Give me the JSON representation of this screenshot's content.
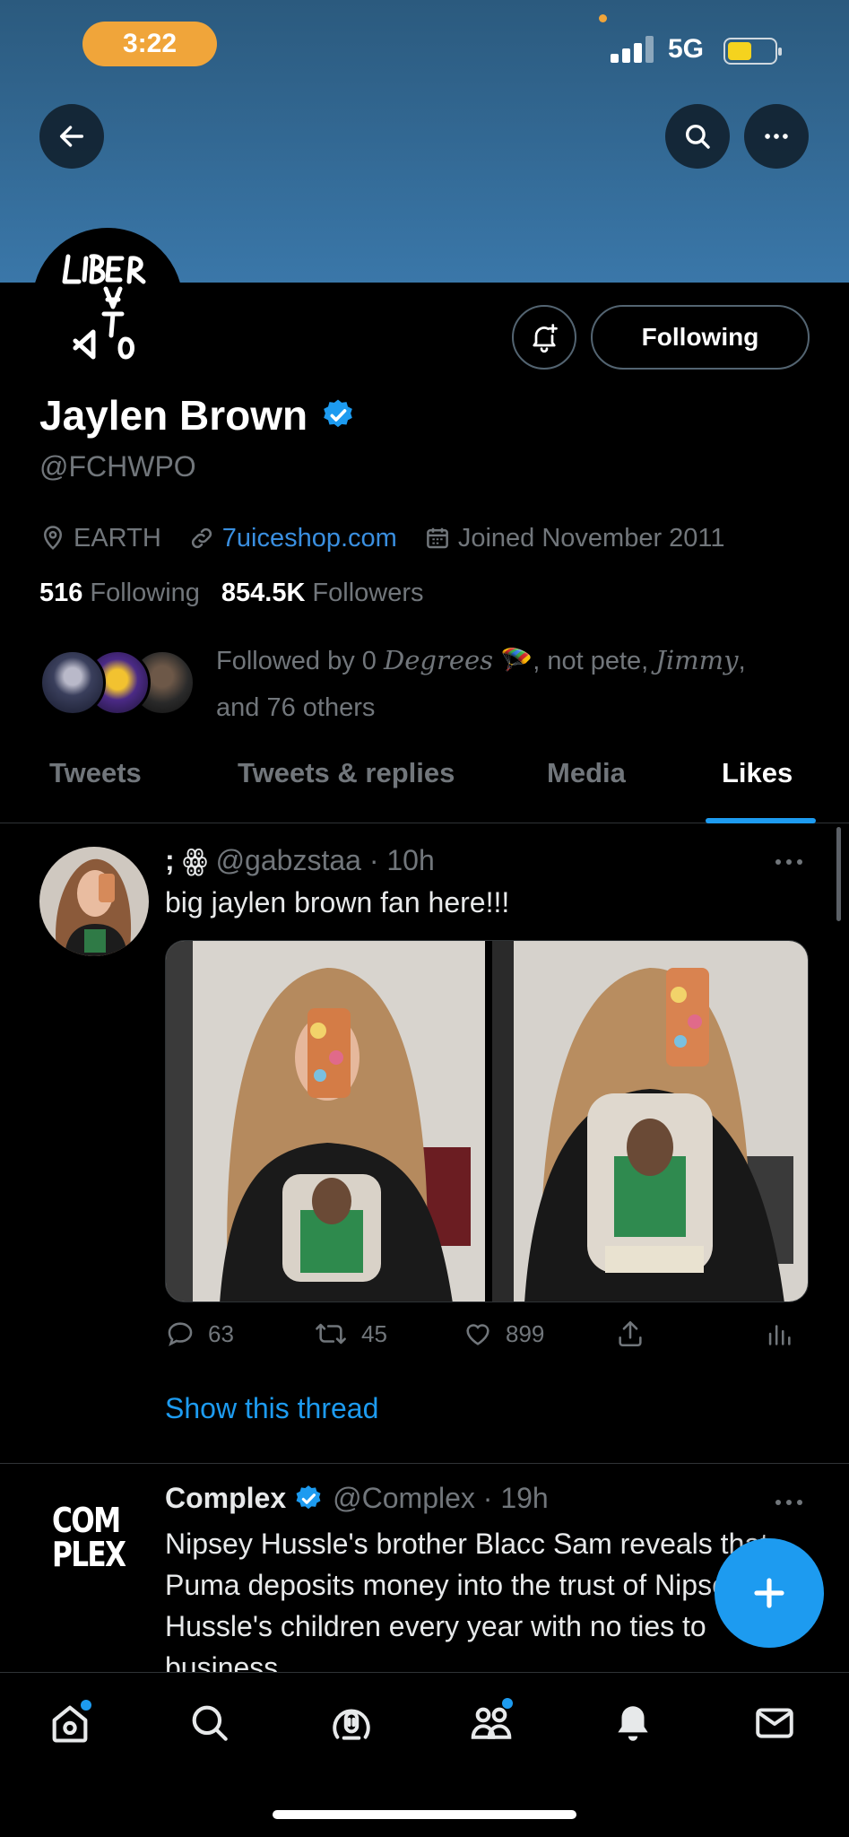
{
  "status": {
    "time": "3:22",
    "network": "5G"
  },
  "profile": {
    "name": "Jaylen Brown",
    "handle": "@FCHWPO",
    "location": "EARTH",
    "website": "7uiceshop.com",
    "joined": "Joined November 2011",
    "following_count": "516",
    "following_label": "Following",
    "followers_count": "854.5K",
    "followers_label": "Followers",
    "followed_by_prefix": "Followed by 0",
    "followed_by_name1": "Degrees",
    "followed_by_mid": ", not pete,",
    "followed_by_name2": "Jimmy",
    "followed_by_suffix": ",",
    "followed_by_others": "and 76 others",
    "following_button": "Following",
    "avatar_logo_text": "LIBERATION"
  },
  "tabs": [
    {
      "label": "Tweets"
    },
    {
      "label": "Tweets & replies"
    },
    {
      "label": "Media"
    },
    {
      "label": "Likes",
      "active": true
    }
  ],
  "tweets": [
    {
      "name": ";",
      "handle": "@gabzstaa",
      "time": "10h",
      "text": "big jaylen brown fan here!!!",
      "replies": "63",
      "retweets": "45",
      "likes": "899",
      "show_thread": "Show this thread"
    },
    {
      "name": "Complex",
      "handle": "@Complex",
      "time": "19h",
      "logo_line1": "COM",
      "logo_line2": "PLEX",
      "text": "Nipsey Hussle's brother Blacc Sam reveals that Puma deposits money into the trust of Nipsey Hussle's children every year with no ties to business"
    }
  ],
  "colors": {
    "accent": "#1d9bf0",
    "banner": "#3a77a9",
    "time_pill": "#f0a53a"
  }
}
